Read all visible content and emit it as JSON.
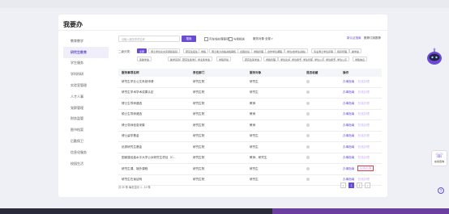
{
  "page": {
    "title": "我要办"
  },
  "sidebar": {
    "items": [
      {
        "label": "教育教学"
      },
      {
        "label": "研究生教育"
      },
      {
        "label": "学生服务"
      },
      {
        "label": "学科科研"
      },
      {
        "label": "实验室管理"
      },
      {
        "label": "人才人事"
      },
      {
        "label": "党群管理"
      },
      {
        "label": "财务监管"
      },
      {
        "label": "图书档案"
      },
      {
        "label": "后勤保卫"
      },
      {
        "label": "信息化服务"
      },
      {
        "label": "校园生活"
      }
    ]
  },
  "search": {
    "placeholder": "请输入服务事项名称",
    "button": "搜索"
  },
  "filters": {
    "online": "可在线办理事项",
    "favorite": "与我相关",
    "target_label": "服务对象",
    "target_value": "全部"
  },
  "links": {
    "new_guide": "新认证指南",
    "recommend": "推荐订阅推荐"
  },
  "categories": {
    "label": "二级分类:",
    "items": [
      {
        "label": "全部",
        "active": true
      },
      {
        "label": "博士学位论文评阅和答辩"
      },
      {
        "label": "研究生招生"
      },
      {
        "label": "学籍"
      },
      {
        "label": "博士能力合格资格审核"
      },
      {
        "label": "出国出境"
      },
      {
        "label": "学籍管理"
      },
      {
        "label": "合作学位课程"
      },
      {
        "label": "学位(含学生资格)"
      },
      {
        "label": "专业博士学位评审"
      },
      {
        "label": "培养管理"
      },
      {
        "label": "助学金"
      },
      {
        "label": "奖助学金"
      },
      {
        "label": "助学贷款"
      },
      {
        "label": "研究生奖学金"
      },
      {
        "label": "学业奖学金"
      },
      {
        "label": "学籍异动"
      },
      {
        "label": "研究生奖学金"
      },
      {
        "label": "学籍管理"
      },
      {
        "label": "学位论文"
      },
      {
        "label": "学位授予"
      },
      {
        "label": "学生管理"
      },
      {
        "label": "学位公示"
      },
      {
        "label": "学位授予"
      },
      {
        "label": "学位公示"
      },
      {
        "label": "学籍信息"
      }
    ]
  },
  "table": {
    "headers": [
      "服务事项名称",
      "责任部门",
      "服务对象",
      "是否收藏",
      "操作"
    ],
    "rows": [
      {
        "name": "研究生学业公文系统申请",
        "dept": "研究生院",
        "target": "研究生",
        "op1": "办事指南",
        "op2": "在线办理"
      },
      {
        "name": "研究生学术学术成果认定",
        "dept": "研究生院",
        "target": "研究生",
        "op1": "办事指南",
        "op2": "在线办理"
      },
      {
        "name": "博士生导师遴选",
        "dept": "研究生院",
        "target": "教师",
        "op1": "办事指南",
        "op2": "在线办理"
      },
      {
        "name": "硕士生导师遴选",
        "dept": "研究生院",
        "target": "教师",
        "op1": "办事指南",
        "op2": "在线办理"
      },
      {
        "name": "博士导师信息采集",
        "dept": "研究生院",
        "target": "教师",
        "op1": "办事指南",
        "op2": "在线办理"
      },
      {
        "name": "博士留学基金",
        "dept": "研究生院",
        "target": "研究生",
        "op1": "办事指南",
        "op2": "在线办理"
      },
      {
        "name": "优秀研究生基金",
        "dept": "研究生院",
        "target": "研究生",
        "op1": "办事指南",
        "op2": "在线办理"
      },
      {
        "name": "国家建设高水平大学公派研究生项目（C...",
        "dept": "研究生院",
        "target": "教师、研究生",
        "op1": "办事指南",
        "op2": "在线办理"
      },
      {
        "name": "研究生课、境外课程",
        "dept": "研究生院",
        "target": "研究生",
        "op1": "办事指南",
        "op2": "在线办理"
      },
      {
        "name": "研究生在读证明",
        "dept": "研究生院",
        "target": "研究生",
        "op1": "办事指南",
        "op2": "在线办理"
      }
    ]
  },
  "pagination": {
    "total": "共 20 条  每页显示 1 - 10 条",
    "pages": [
      "<",
      "1",
      "2",
      ">"
    ],
    "active": "1"
  },
  "side_widget": {
    "label": "在线咨询"
  },
  "help": {
    "label": "?"
  }
}
